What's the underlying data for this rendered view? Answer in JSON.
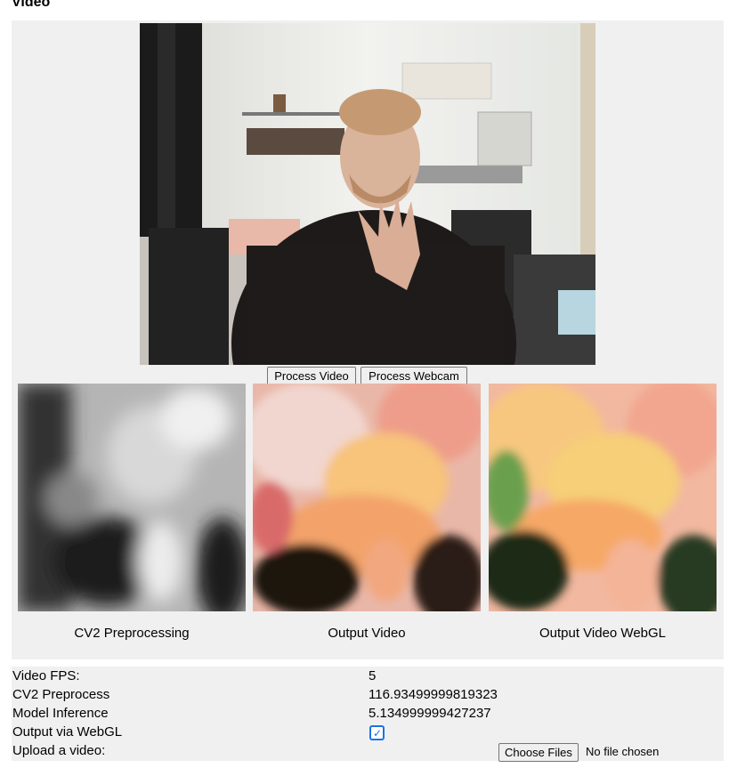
{
  "section_title": "Video",
  "buttons": {
    "process_video": "Process Video",
    "process_webcam": "Process Webcam"
  },
  "captions": {
    "preprocessing": "CV2 Preprocessing",
    "output_video": "Output Video",
    "output_webgl": "Output Video WebGL"
  },
  "stats": {
    "fps_label": "Video FPS:",
    "fps_value": "5",
    "preprocess_label": "CV2 Preprocess",
    "preprocess_value": "116.93499999819323",
    "inference_label": "Model Inference",
    "inference_value": "5.134999999427237",
    "webgl_label": "Output via WebGL",
    "webgl_checked": true,
    "upload_label": "Upload a video:",
    "choose_files": "Choose Files",
    "no_file": "No file chosen"
  },
  "icons": {
    "checkbox": "checkmark-icon"
  }
}
